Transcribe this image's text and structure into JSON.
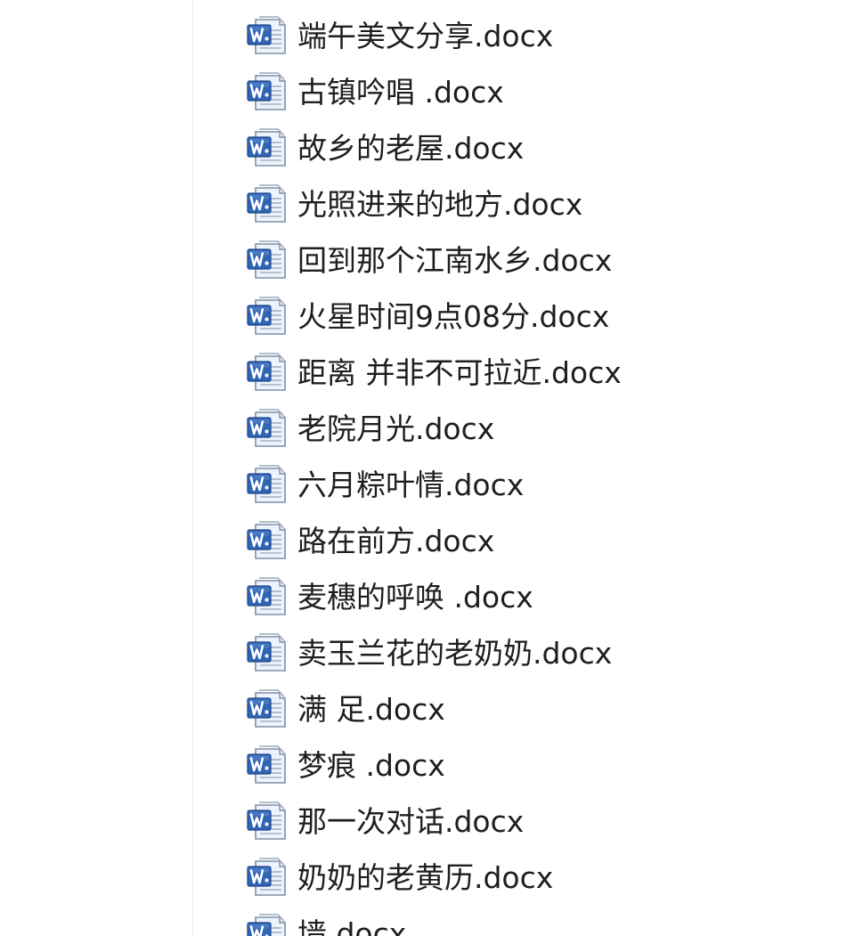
{
  "file_list": {
    "icon": "word-document-icon",
    "accent_color": "#2f64b6",
    "items": [
      {
        "name": "端午美文分享.docx"
      },
      {
        "name": "古镇吟唱 .docx"
      },
      {
        "name": "故乡的老屋.docx"
      },
      {
        "name": "光照进来的地方.docx"
      },
      {
        "name": "回到那个江南水乡.docx"
      },
      {
        "name": "火星时间9点08分.docx"
      },
      {
        "name": "距离 并非不可拉近.docx"
      },
      {
        "name": "老院月光.docx"
      },
      {
        "name": "六月粽叶情.docx"
      },
      {
        "name": "路在前方.docx"
      },
      {
        "name": "麦穗的呼唤 .docx"
      },
      {
        "name": "卖玉兰花的老奶奶.docx"
      },
      {
        "name": "满  足.docx"
      },
      {
        "name": "梦痕 .docx"
      },
      {
        "name": "那一次对话.docx"
      },
      {
        "name": "奶奶的老黄历.docx"
      },
      {
        "name": "墙.docx"
      }
    ]
  }
}
